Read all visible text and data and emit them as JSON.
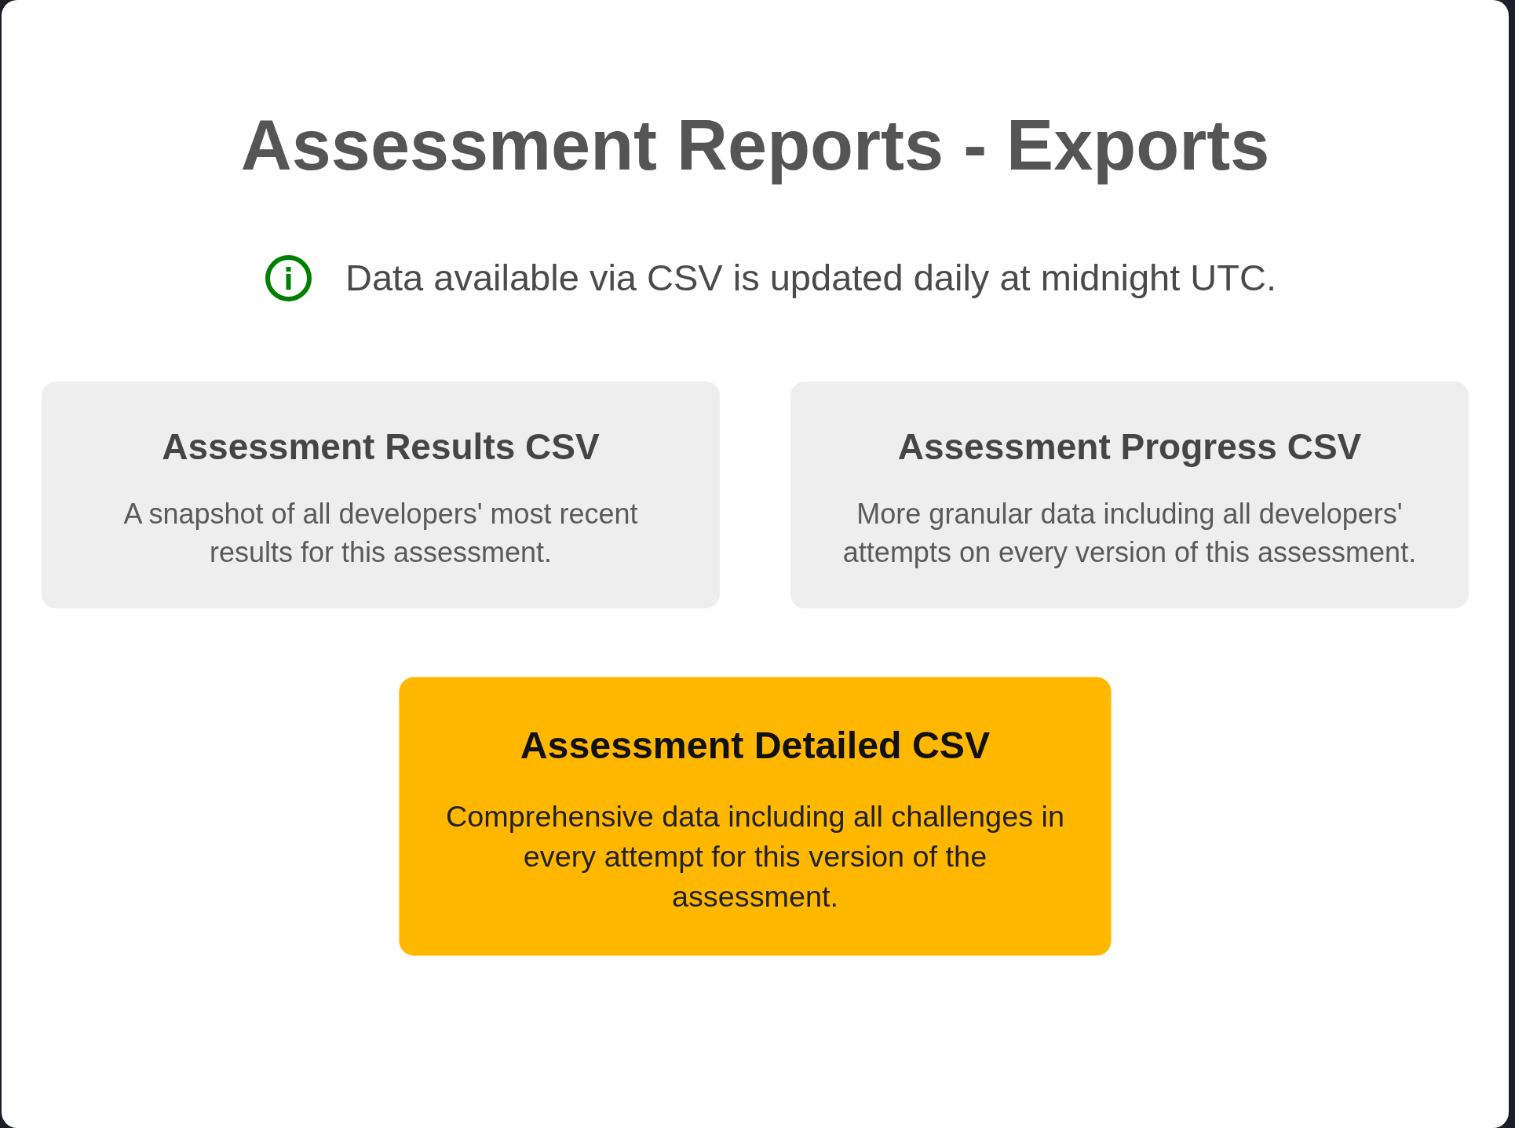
{
  "title": "Assessment Reports - Exports",
  "notice": {
    "text": "Data available via CSV is updated daily at midnight UTC."
  },
  "exports": [
    {
      "title": "Assessment Results CSV",
      "description": "A snapshot of all developers' most recent results for this assessment.",
      "selected": false
    },
    {
      "title": "Assessment Progress CSV",
      "description": "More granular data including all developers' attempts on every version of this assessment.",
      "selected": false
    },
    {
      "title": "Assessment Detailed CSV",
      "description": "Comprehensive data including all challenges in every attempt for this version of the assessment.",
      "selected": true
    }
  ]
}
